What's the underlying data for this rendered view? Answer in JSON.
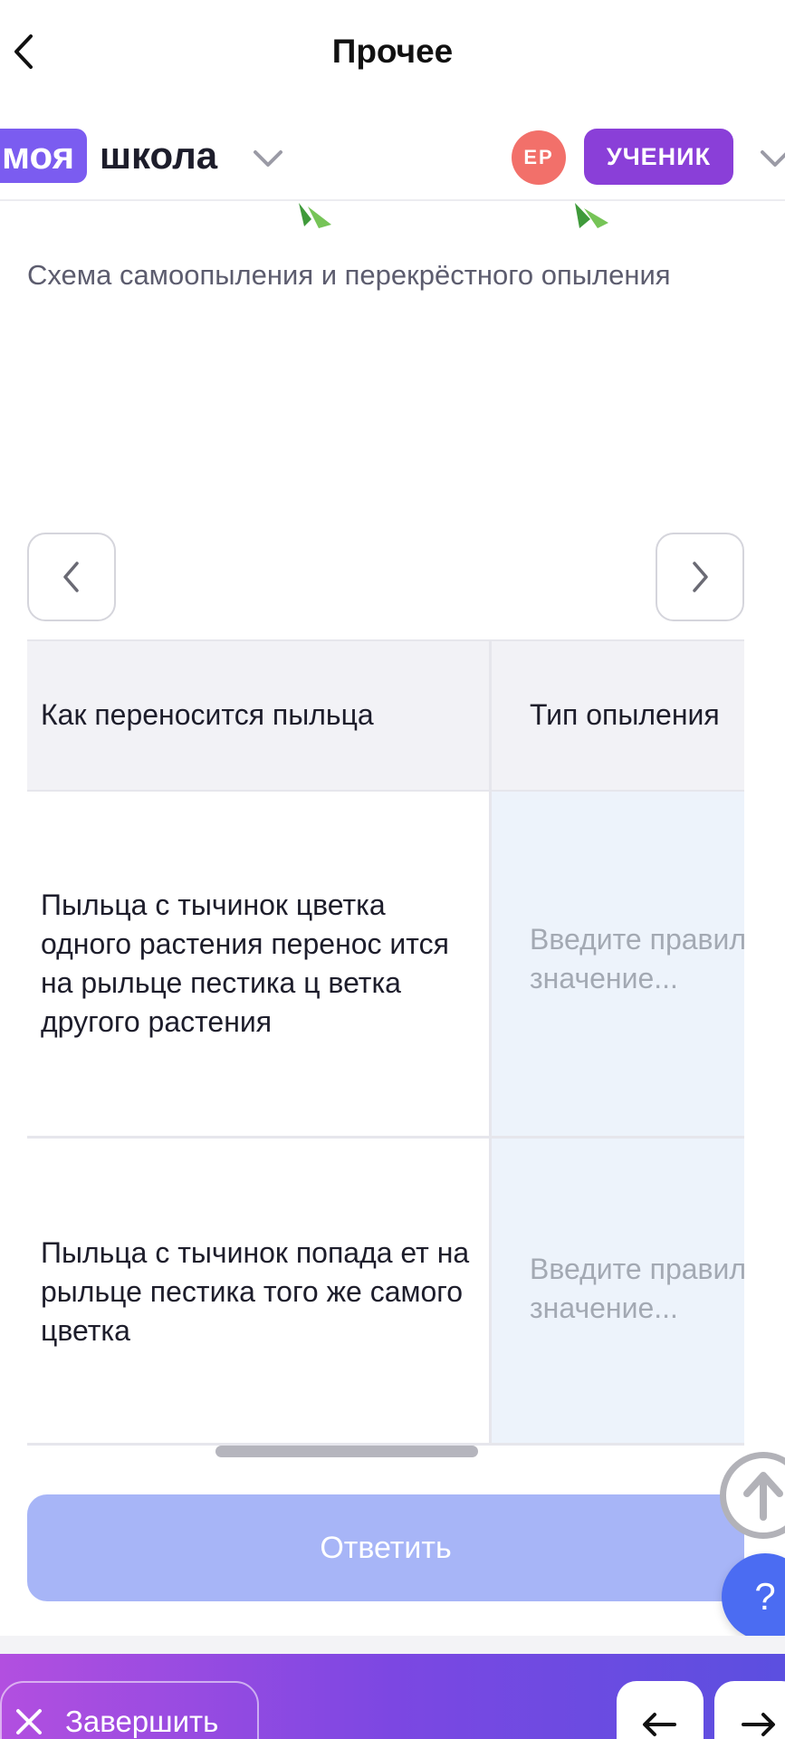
{
  "topnav": {
    "title": "Прочее"
  },
  "header": {
    "logo_part1": "моя",
    "logo_part2": "школа",
    "avatar_initials": "ЕР",
    "role": "УЧЕНИК"
  },
  "content": {
    "caption": "Схема самоопыления и перекрёстного опыления"
  },
  "table": {
    "headers": [
      "Как переносится пыльца",
      "Тип опыления"
    ],
    "rows": [
      {
        "text": "Пыльца с тычинок цветка одного растения перенос ится на рыльце пестика ц ветка другого растения",
        "placeholder": "Введите правильное значение..."
      },
      {
        "text": "Пыльца с тычинок попада ет на рыльце пестика того же самого цветка",
        "placeholder": "Введите правильное значение..."
      }
    ]
  },
  "actions": {
    "answer_label": "Ответить",
    "help_label": "?",
    "finish_label": "Завершить"
  },
  "colors": {
    "brand": "#7b5cf0",
    "role_badge": "#8a3fd8",
    "avatar": "#f2706a",
    "answer_button": "#a7b5f7",
    "help_button": "#4b6cf2",
    "input_cell": "#edf3fb"
  }
}
